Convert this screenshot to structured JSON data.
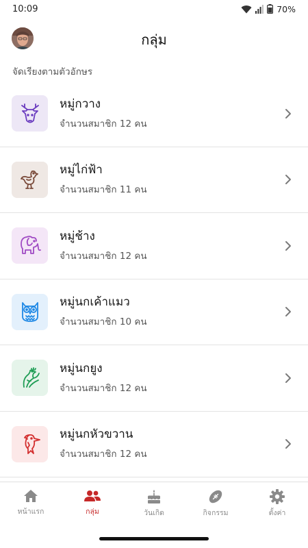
{
  "status": {
    "time": "10:09",
    "battery": "70%"
  },
  "header": {
    "title": "กลุ่ม"
  },
  "sort_label": "จัดเรียงตามตัวอักษร",
  "groups": [
    {
      "name": "หมู่กวาง",
      "count": "จำนวนสมาชิก 12 คน",
      "icon": "deer-icon",
      "icon_color": "#6a3bbf",
      "bg": "#ede7f6"
    },
    {
      "name": "หมู่ไก่ฟ้า",
      "count": "จำนวนสมาชิก 11 คน",
      "icon": "pheasant-icon",
      "icon_color": "#7a4a3a",
      "bg": "#efe8e4"
    },
    {
      "name": "หมู่ช้าง",
      "count": "จำนวนสมาชิก 12 คน",
      "icon": "elephant-icon",
      "icon_color": "#a04bc4",
      "bg": "#f4e6f7"
    },
    {
      "name": "หมู่นกเค้าแมว",
      "count": "จำนวนสมาชิก 10 คน",
      "icon": "owl-icon",
      "icon_color": "#1e88e5",
      "bg": "#e3f0fc"
    },
    {
      "name": "หมู่นกยูง",
      "count": "จำนวนสมาชิก 12 คน",
      "icon": "peacock-icon",
      "icon_color": "#1f9d55",
      "bg": "#e5f4ea"
    },
    {
      "name": "หมู่นกหัวขวาน",
      "count": "จำนวนสมาชิก 12 คน",
      "icon": "woodpecker-icon",
      "icon_color": "#d32f2f",
      "bg": "#fce8e8"
    }
  ],
  "nav": [
    {
      "label": "หน้าแรก",
      "icon": "home-icon"
    },
    {
      "label": "กลุ่ม",
      "icon": "group-icon",
      "active": true
    },
    {
      "label": "วันเกิด",
      "icon": "cake-icon"
    },
    {
      "label": "กิจกรรม",
      "icon": "football-icon"
    },
    {
      "label": "ตั้งค่า",
      "icon": "gear-icon"
    }
  ]
}
